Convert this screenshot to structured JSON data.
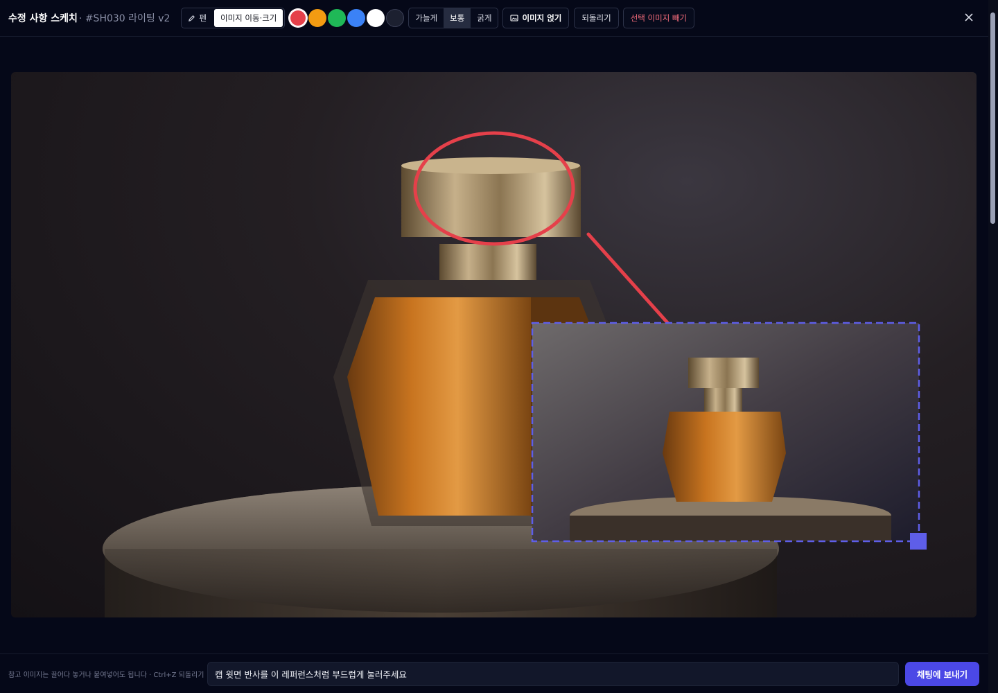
{
  "header": {
    "title": "수정 사항 스케치",
    "subtitle": "· #SH030 라이팅 v2",
    "tools": {
      "pen": "펜",
      "move": "이미지 이동·크기"
    },
    "colors": [
      "#e5404a",
      "#f39b12",
      "#1fb857",
      "#3b82f6",
      "#ffffff",
      "#1c2030"
    ],
    "stroke": {
      "thin": "가늘게",
      "normal": "보통",
      "thick": "굵게"
    },
    "insert_image": "이미지 얹기",
    "undo": "되돌리기",
    "remove_selected": "선택 이미지 빼기",
    "close_icon": "close-icon"
  },
  "footer": {
    "hint": "참고 이미지는 끌어다 놓거나 붙여넣어도 됩니다 · Ctrl+Z 되돌리기",
    "note_value": "캡 윗면 반사를 이 레퍼런스처럼 부드럽게 눌러주세요",
    "send": "채팅에 보내기"
  },
  "accent": "#4b48e6",
  "annotation_color": "#e5404a"
}
